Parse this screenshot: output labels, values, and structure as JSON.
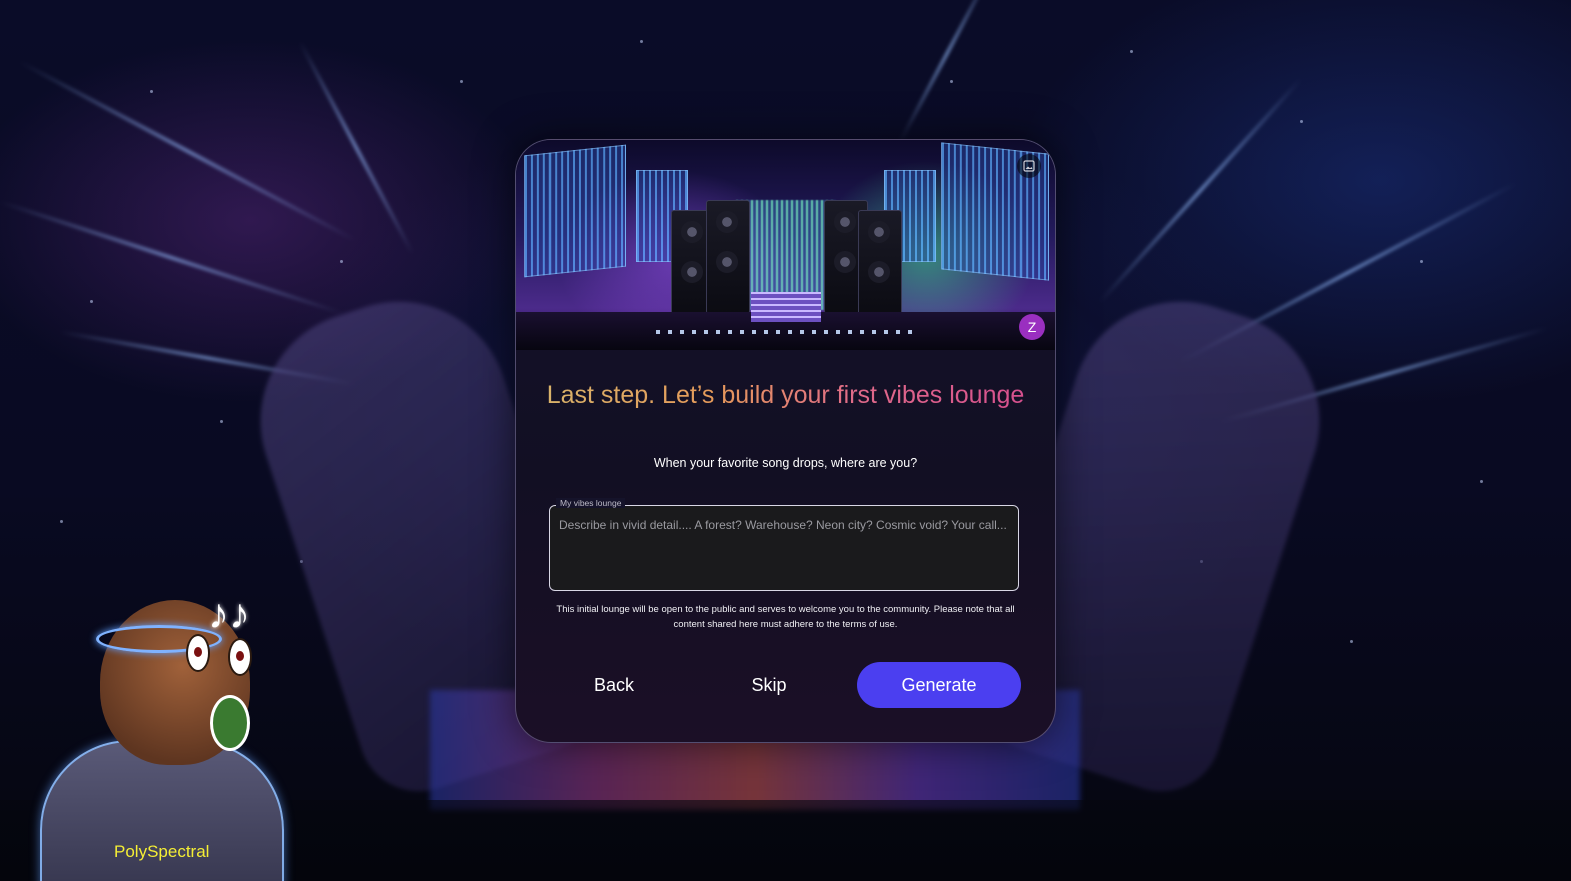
{
  "modal": {
    "title": "Last step. Let’s build your first vibes lounge",
    "subtitle": "When your favorite song drops, where are you?",
    "field": {
      "label": "My vibes lounge",
      "placeholder": "Describe in vivid detail.... A forest? Warehouse? Neon city? Cosmic void? Your call..."
    },
    "notice": "This initial lounge will be open to the public and serves to welcome you to the community. Please note that all content shared here must adhere to the terms of use.",
    "buttons": {
      "back": "Back",
      "skip": "Skip",
      "generate": "Generate"
    },
    "avatar_initial": "Z",
    "banner_icon": "image-icon"
  },
  "character": {
    "name": "PolySpectral",
    "note_glyph": "♪♪"
  },
  "colors": {
    "accent": "#4b3ff0",
    "avatar": "#9a2fc0",
    "name_tag": "#f4ee35",
    "title_gradient_start": "#d9b36a",
    "title_gradient_end": "#d6508e"
  }
}
